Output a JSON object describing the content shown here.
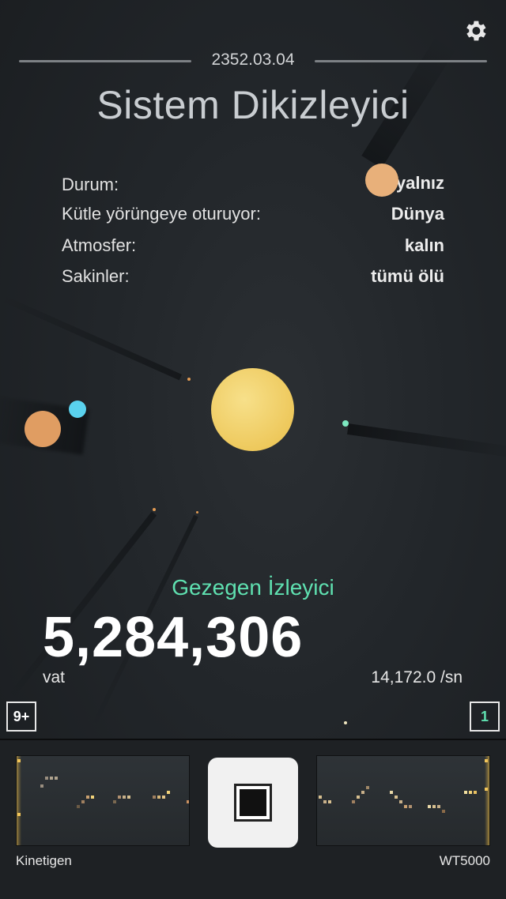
{
  "header": {
    "date": "2352.03.04",
    "title": "Sistem Dikizleyici"
  },
  "info": [
    {
      "label": "Durum:",
      "value": "yalnız"
    },
    {
      "label": "Kütle yörüngeye oturuyor:",
      "value": "Dünya"
    },
    {
      "label": "Atmosfer:",
      "value": "kalın"
    },
    {
      "label": "Sakinler:",
      "value": "tümü ölü"
    }
  ],
  "tracker": {
    "label": "Gezegen İzleyici",
    "count": "5,284,306",
    "unit": "vat",
    "rate": "14,172.0 /sn"
  },
  "badges": {
    "left": "9+",
    "right": "1"
  },
  "modules": {
    "left_name": "Kinetigen",
    "right_name": "WT5000"
  },
  "colors": {
    "accent": "#5fe0b0",
    "sun": "#f2d36b",
    "planet_orange": "#e8a56f",
    "planet_blue": "#5ad2ee",
    "background": "#22262a"
  },
  "icons": {
    "settings": "gear-icon",
    "stop": "stop-icon"
  }
}
